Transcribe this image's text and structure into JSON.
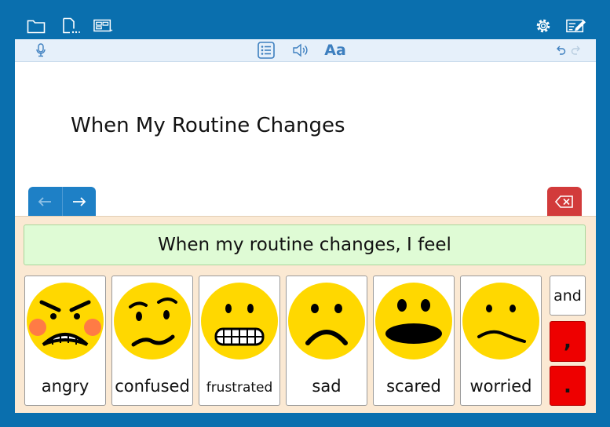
{
  "toolbar": {
    "icons": [
      "folder-icon",
      "new-document-icon",
      "layout-icon",
      "settings-icon",
      "edit-mode-icon"
    ]
  },
  "doc_toolbar": {
    "icons": [
      "microphone-icon",
      "word-list-icon",
      "speaker-icon",
      "undo-icon",
      "redo-icon"
    ],
    "font_label": "Aa"
  },
  "document": {
    "title": "When My Routine Changes"
  },
  "navigation": {
    "back_icon": "arrow-left-icon",
    "forward_icon": "arrow-right-icon",
    "delete_icon": "backspace-icon"
  },
  "grid": {
    "sentence": "When my routine changes, I feel",
    "cards": [
      {
        "label": "angry",
        "icon": "angry-face-icon"
      },
      {
        "label": "confused",
        "icon": "confused-face-icon"
      },
      {
        "label": "frustrated",
        "icon": "frustrated-face-icon"
      },
      {
        "label": "sad",
        "icon": "sad-face-icon"
      },
      {
        "label": "scared",
        "icon": "scared-face-icon"
      },
      {
        "label": "worried",
        "icon": "worried-face-icon"
      }
    ],
    "and_label": "and",
    "comma_label": ",",
    "period_label": "."
  },
  "colors": {
    "frame": "#0a6fae",
    "nav_blue": "#1e80c6",
    "delete_red": "#d23b3b",
    "sentence_green": "#dffbd5",
    "grid_bg": "#fbe9d3",
    "punct_red": "#ee0000",
    "face_yellow": "#ffd800"
  }
}
